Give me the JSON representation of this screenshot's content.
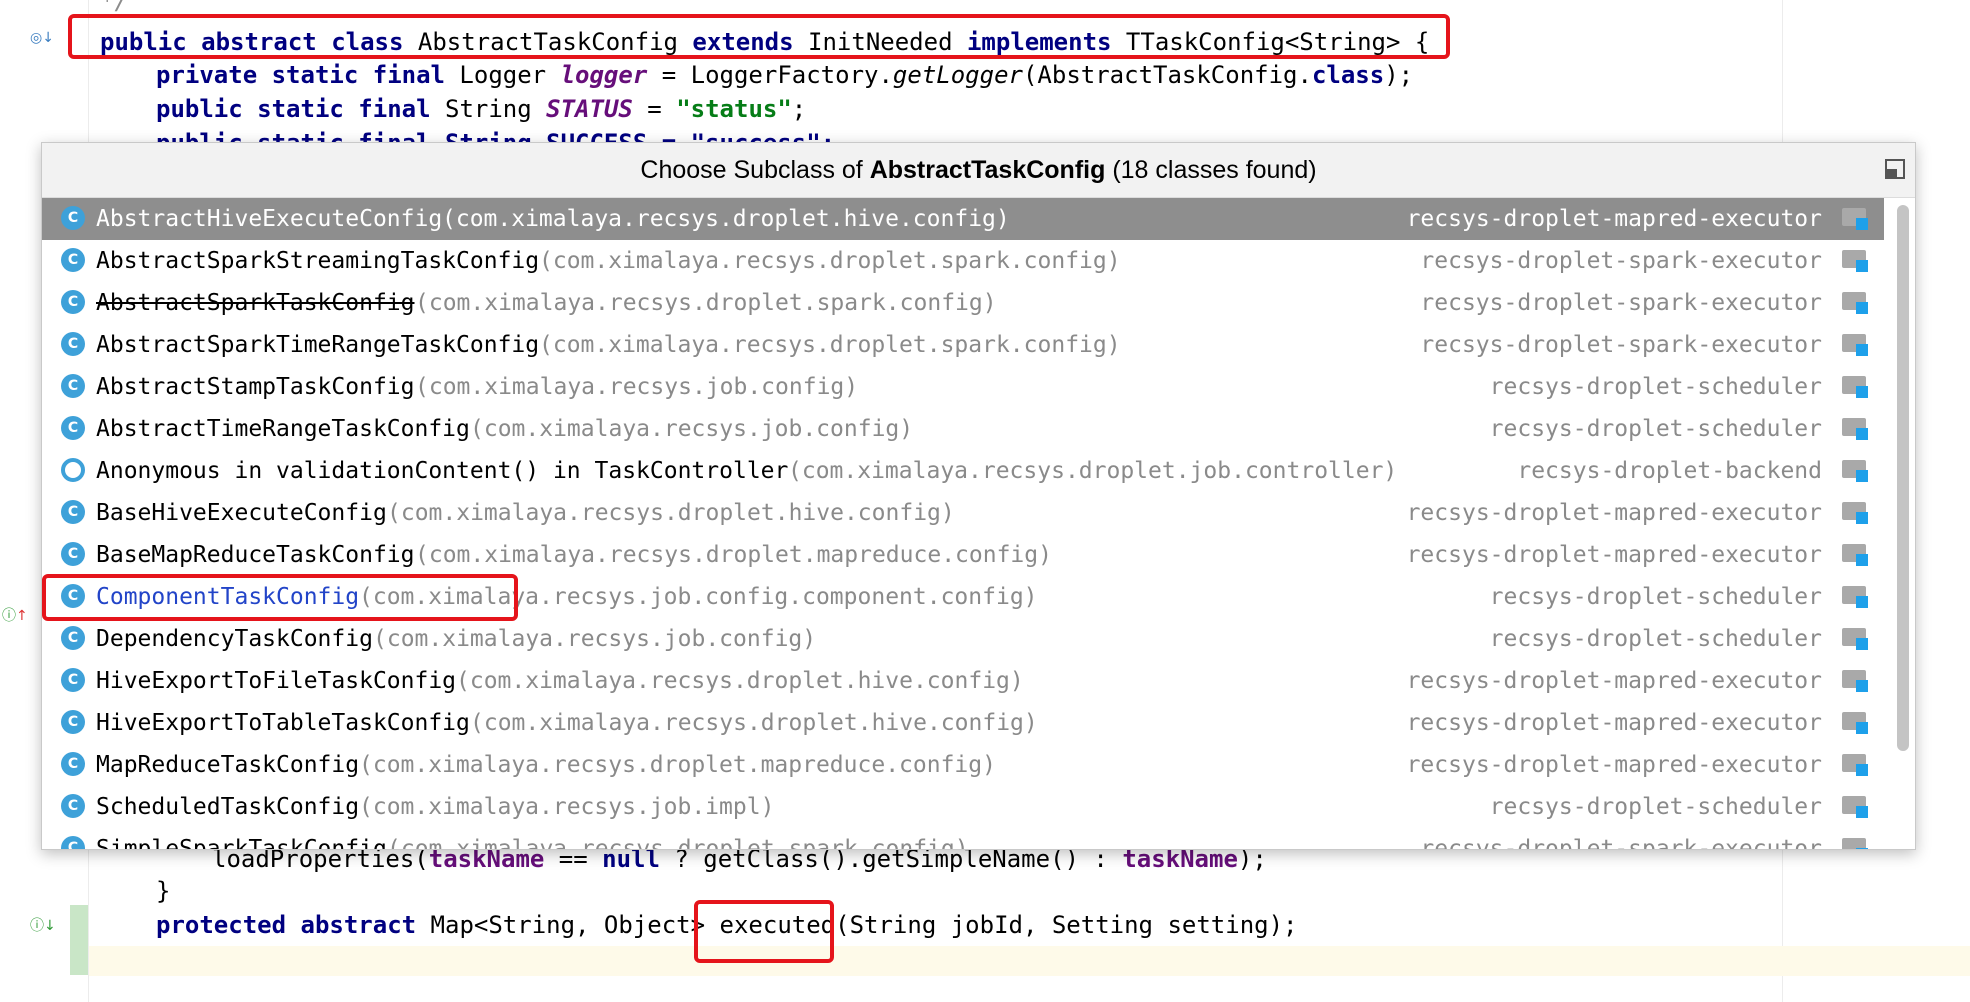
{
  "editor": {
    "top_partial": "*/",
    "class_decl": {
      "kw1": "public abstract class",
      "name": " AbstractTaskConfig ",
      "kw2": "extends",
      "super": " InitNeeded ",
      "kw3": "implements",
      "iface": " TTaskConfig<String> {"
    },
    "logger_line": {
      "kw": "private static final",
      "type": " Logger ",
      "field": "logger",
      "rest1": " = LoggerFactory.",
      "call": "getLogger",
      "rest2": "(AbstractTaskConfig.",
      "kwclass": "class",
      "end": ");"
    },
    "status_line": {
      "kw": "public static final",
      "type": " String ",
      "field": "STATUS",
      "eq": " = ",
      "val": "\"status\"",
      "end": ";"
    },
    "success_partial": "public static final String SUCCESS = \"success\";",
    "load_line": {
      "pre": "loadProperties(",
      "f1": "taskName",
      "mid1": " == ",
      "kwnull": "null",
      "mid2": " ? getClass().getSimpleName() : ",
      "f2": "taskName",
      "end": ");"
    },
    "close_brace": "}",
    "executed_line": {
      "kw": "protected abstract",
      "rest": " Map<String, Object> executed(String jobId, Setting setting);"
    }
  },
  "popup": {
    "title_prefix": "Choose Subclass of ",
    "title_class": "AbstractTaskConfig",
    "title_suffix": " (18 classes found)",
    "items": [
      {
        "name": "AbstractHiveExecuteConfig",
        "pkg": " (com.ximalaya.recsys.droplet.hive.config)",
        "module": "recsys-droplet-mapred-executor"
      },
      {
        "name": "AbstractSparkStreamingTaskConfig",
        "pkg": " (com.ximalaya.recsys.droplet.spark.config)",
        "module": "recsys-droplet-spark-executor"
      },
      {
        "name": "AbstractSparkTaskConfig",
        "pkg": " (com.ximalaya.recsys.droplet.spark.config)",
        "module": "recsys-droplet-spark-executor"
      },
      {
        "name": "AbstractSparkTimeRangeTaskConfig",
        "pkg": " (com.ximalaya.recsys.droplet.spark.config)",
        "module": "recsys-droplet-spark-executor"
      },
      {
        "name": "AbstractStampTaskConfig",
        "pkg": " (com.ximalaya.recsys.job.config)",
        "module": "recsys-droplet-scheduler"
      },
      {
        "name": "AbstractTimeRangeTaskConfig",
        "pkg": " (com.ximalaya.recsys.job.config)",
        "module": "recsys-droplet-scheduler"
      },
      {
        "name": "Anonymous in validationContent() in TaskController",
        "pkg": " (com.ximalaya.recsys.droplet.job.controller)",
        "module": "recsys-droplet-backend"
      },
      {
        "name": "BaseHiveExecuteConfig",
        "pkg": " (com.ximalaya.recsys.droplet.hive.config)",
        "module": "recsys-droplet-mapred-executor"
      },
      {
        "name": "BaseMapReduceTaskConfig",
        "pkg": " (com.ximalaya.recsys.droplet.mapreduce.config)",
        "module": "recsys-droplet-mapred-executor"
      },
      {
        "name": "ComponentTaskConfig",
        "pkg": " (com.ximalaya.recsys.job.config.component.config)",
        "module": "recsys-droplet-scheduler"
      },
      {
        "name": "DependencyTaskConfig",
        "pkg": " (com.ximalaya.recsys.job.config)",
        "module": "recsys-droplet-scheduler"
      },
      {
        "name": "HiveExportToFileTaskConfig",
        "pkg": " (com.ximalaya.recsys.droplet.hive.config)",
        "module": "recsys-droplet-mapred-executor"
      },
      {
        "name": "HiveExportToTableTaskConfig",
        "pkg": " (com.ximalaya.recsys.droplet.hive.config)",
        "module": "recsys-droplet-mapred-executor"
      },
      {
        "name": "MapReduceTaskConfig",
        "pkg": " (com.ximalaya.recsys.droplet.mapreduce.config)",
        "module": "recsys-droplet-mapred-executor"
      },
      {
        "name": "ScheduledTaskConfig",
        "pkg": " (com.ximalaya.recsys.job.impl)",
        "module": "recsys-droplet-scheduler"
      },
      {
        "name": "SimpleSparkTaskConfig",
        "pkg": " (com.ximalaya.recsys.droplet.spark.config)",
        "module": "recsys-droplet-spark-executor"
      }
    ]
  }
}
